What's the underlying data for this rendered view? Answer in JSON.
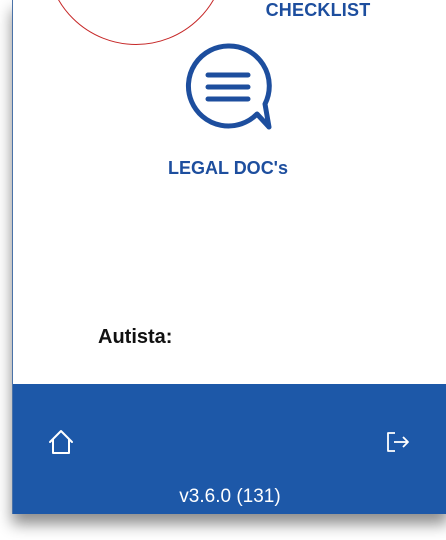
{
  "menu": {
    "checklist_label": "CHECKLIST",
    "legal_docs_label": "LEGAL DOC's"
  },
  "driver": {
    "label": "Autista:"
  },
  "footer": {
    "version": "v3.6.0 (131)"
  },
  "icons": {
    "legal_docs": "chat-bubble-lines-icon",
    "home": "home-icon",
    "logout": "logout-icon"
  },
  "colors": {
    "accent": "#1d4e9e",
    "bottom_bar": "#1d58a8",
    "circle_outline": "#c62828"
  }
}
